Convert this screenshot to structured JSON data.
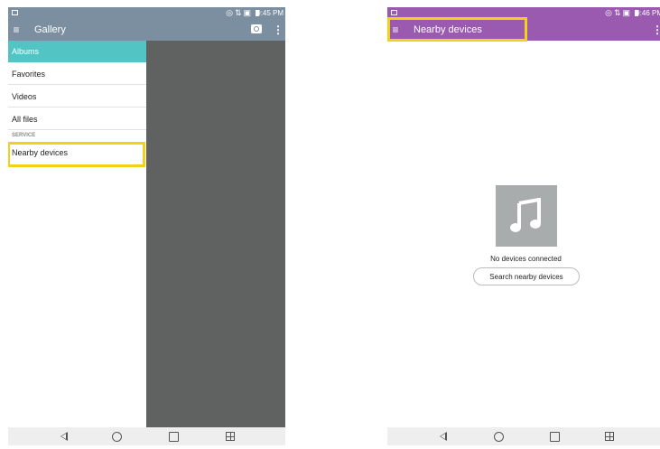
{
  "left_screen": {
    "status": {
      "time": "9:45 PM"
    },
    "app_bar": {
      "title": "Gallery",
      "menu_icon": "hamburger-icon",
      "camera_icon": "camera-icon",
      "overflow_icon": "overflow-menu-icon"
    },
    "drawer": {
      "items": [
        {
          "label": "Albums",
          "active": true
        },
        {
          "label": "Favorites"
        },
        {
          "label": "Videos"
        },
        {
          "label": "All files"
        }
      ],
      "section_header": "SERVICE",
      "service_item": "Nearby devices"
    },
    "accent_color": "#52C4C4",
    "highlight_color": "#F3D11A"
  },
  "right_screen": {
    "status": {
      "time": "9:46 PM"
    },
    "app_bar": {
      "title": "Nearby devices",
      "menu_icon": "hamburger-icon",
      "overflow_icon": "overflow-menu-icon"
    },
    "empty_state": {
      "icon": "music-note-icon",
      "message": "No devices connected",
      "button": "Search nearby devices"
    },
    "accent_color": "#9A5AB0"
  },
  "nav_bar": {
    "buttons": [
      "back-icon",
      "home-icon",
      "recent-apps-icon",
      "dual-window-icon"
    ]
  }
}
